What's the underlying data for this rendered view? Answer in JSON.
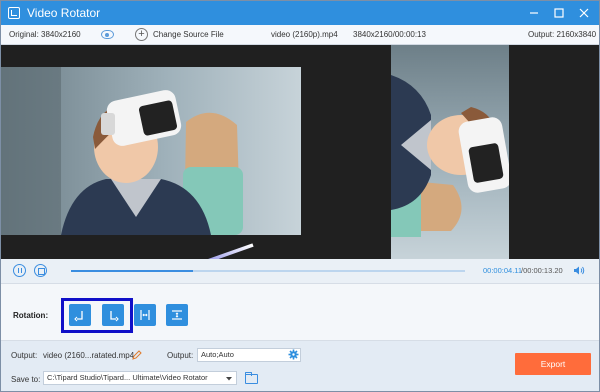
{
  "window": {
    "title": "Video Rotator"
  },
  "info": {
    "original_label": "Original: 3840x2160",
    "change_source": "Change Source File",
    "file_name": "video (2160p).mp4",
    "file_meta": "3840x2160/00:00:13",
    "output_label": "Output: 2160x3840"
  },
  "player": {
    "current_time": "00:00:04.11",
    "total_time": "/00:00:13.20",
    "progress_fraction": 0.31
  },
  "rotation": {
    "label": "Rotation:",
    "buttons": [
      {
        "name": "rotate-left-button",
        "icon": "rotate-left-icon"
      },
      {
        "name": "rotate-right-button",
        "icon": "rotate-right-icon"
      },
      {
        "name": "flip-horizontal-button",
        "icon": "flip-horizontal-icon"
      },
      {
        "name": "flip-vertical-button",
        "icon": "flip-vertical-icon"
      }
    ]
  },
  "bottom": {
    "output_label": "Output:",
    "output_file": "video (2160...ratated.mp4",
    "output_format_label": "Output:",
    "output_format": "Auto;Auto",
    "save_label": "Save to:",
    "save_path": "C:\\Tipard Studio\\Tipard... Ultimate\\Video Rotator",
    "export_label": "Export"
  },
  "colors": {
    "accent": "#2f8fde",
    "export": "#ff6c3b",
    "highlight": "#1010c8"
  }
}
